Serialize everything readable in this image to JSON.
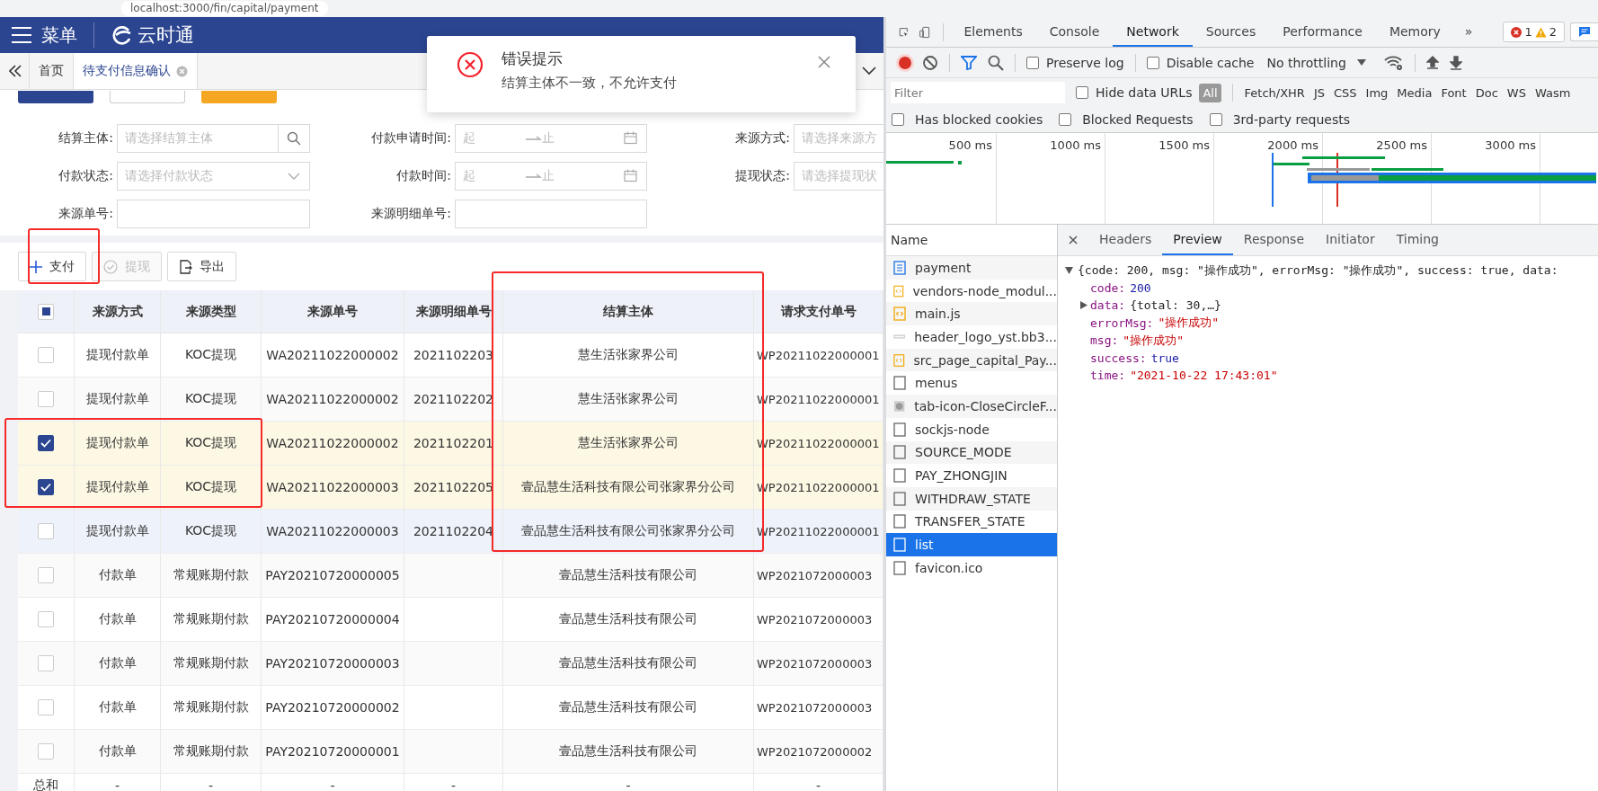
{
  "address_bar": {
    "url": "localhost:3000/fin/capital/payment"
  },
  "header": {
    "menu_label": "菜单",
    "brand": "云时通"
  },
  "page_tabs": [
    {
      "label": "首页",
      "selected": false,
      "closable": false
    },
    {
      "label": "待支付信息确认",
      "selected": true,
      "closable": true
    }
  ],
  "query_buttons": [
    {
      "kind": "primary"
    },
    {
      "kind": "default"
    },
    {
      "kind": "warning"
    }
  ],
  "filters": [
    {
      "label": "结算主体:",
      "kind": "search",
      "placeholder": "请选择结算主体"
    },
    {
      "label": "付款申请时间:",
      "kind": "daterange",
      "start": "起",
      "end": "止"
    },
    {
      "label": "来源方式:",
      "kind": "text",
      "placeholder": "请选择来源方"
    },
    {
      "label": "付款状态:",
      "kind": "select",
      "placeholder": "请选择付款状态"
    },
    {
      "label": "付款时间:",
      "kind": "daterange",
      "start": "起",
      "end": "止"
    },
    {
      "label": "提现状态:",
      "kind": "text",
      "placeholder": "请选择提现状"
    },
    {
      "label": "来源单号:",
      "kind": "text"
    },
    {
      "label": "来源明细单号:",
      "kind": "text"
    }
  ],
  "toolbar": [
    {
      "label": "支付",
      "kind": "add",
      "disabled": false
    },
    {
      "label": "提现",
      "kind": "confirm",
      "disabled": true
    },
    {
      "label": "导出",
      "kind": "export",
      "disabled": false
    }
  ],
  "table": {
    "header_checkbox": {
      "indeterminate": true
    },
    "columns": [
      "来源方式",
      "来源类型",
      "来源单号",
      "来源明细单号",
      "结算主体",
      "请求支付单号"
    ],
    "rows": [
      {
        "checked": false,
        "hovered": false,
        "cells": [
          "提现付款单",
          "KOC提现",
          "WA20211022000002",
          "2021102203",
          "慧生活张家界公司",
          "WP20211022000001"
        ]
      },
      {
        "checked": false,
        "hovered": false,
        "cells": [
          "提现付款单",
          "KOC提现",
          "WA20211022000002",
          "2021102202",
          "慧生活张家界公司",
          "WP20211022000001"
        ]
      },
      {
        "checked": true,
        "hovered": false,
        "cells": [
          "提现付款单",
          "KOC提现",
          "WA20211022000002",
          "2021102201",
          "慧生活张家界公司",
          "WP20211022000001"
        ]
      },
      {
        "checked": true,
        "hovered": false,
        "cells": [
          "提现付款单",
          "KOC提现",
          "WA20211022000003",
          "2021102205",
          "壹品慧生活科技有限公司张家界分公司",
          "WP20211022000001"
        ]
      },
      {
        "checked": false,
        "hovered": true,
        "cells": [
          "提现付款单",
          "KOC提现",
          "WA20211022000003",
          "2021102204",
          "壹品慧生活科技有限公司张家界分公司",
          "WP20211022000001"
        ]
      },
      {
        "checked": false,
        "hovered": false,
        "cells": [
          "付款单",
          "常规账期付款",
          "PAY20210720000005",
          "",
          "壹品慧生活科技有限公司",
          "WP2021072000003"
        ]
      },
      {
        "checked": false,
        "hovered": false,
        "cells": [
          "付款单",
          "常规账期付款",
          "PAY20210720000004",
          "",
          "壹品慧生活科技有限公司",
          "WP2021072000003"
        ]
      },
      {
        "checked": false,
        "hovered": false,
        "cells": [
          "付款单",
          "常规账期付款",
          "PAY20210720000003",
          "",
          "壹品慧生活科技有限公司",
          "WP2021072000003"
        ]
      },
      {
        "checked": false,
        "hovered": false,
        "cells": [
          "付款单",
          "常规账期付款",
          "PAY20210720000002",
          "",
          "壹品慧生活科技有限公司",
          "WP2021072000003"
        ]
      },
      {
        "checked": false,
        "hovered": false,
        "cells": [
          "付款单",
          "常规账期付款",
          "PAY20210720000001",
          "",
          "壹品慧生活科技有限公司",
          "WP2021072000002"
        ]
      }
    ],
    "summary": {
      "label": "总和",
      "cells": [
        "-",
        "-",
        "-",
        "-",
        "-",
        "-"
      ]
    }
  },
  "toast": {
    "title": "错误提示",
    "message": "结算主体不一致，不允许支付"
  },
  "devtools": {
    "panel_tabs": [
      {
        "label": "Elements",
        "selected": false
      },
      {
        "label": "Console",
        "selected": false
      },
      {
        "label": "Network",
        "selected": true
      },
      {
        "label": "Sources",
        "selected": false
      },
      {
        "label": "Performance",
        "selected": false
      },
      {
        "label": "Memory",
        "selected": false
      }
    ],
    "more": "»",
    "errors": "1",
    "warnings": "2",
    "recording": true,
    "options": [
      {
        "label": "Preserve log",
        "checked": false
      },
      {
        "label": "Disable cache",
        "checked": false
      }
    ],
    "throttling": "No throttling",
    "filter": {
      "placeholder": "Filter",
      "hide_data_urls": {
        "label": "Hide data URLs",
        "checked": false
      },
      "types": [
        {
          "label": "All",
          "selected": true
        },
        {
          "label": "Fetch/XHR",
          "selected": false
        },
        {
          "label": "JS",
          "selected": false
        },
        {
          "label": "CSS",
          "selected": false
        },
        {
          "label": "Img",
          "selected": false
        },
        {
          "label": "Media",
          "selected": false
        },
        {
          "label": "Font",
          "selected": false
        },
        {
          "label": "Doc",
          "selected": false
        },
        {
          "label": "WS",
          "selected": false
        },
        {
          "label": "Wasm",
          "selected": false
        }
      ]
    },
    "extra_filters": [
      {
        "label": "Has blocked cookies",
        "checked": false
      },
      {
        "label": "Blocked Requests",
        "checked": false
      },
      {
        "label": "3rd-party requests",
        "checked": false
      }
    ],
    "timeline_ticks": [
      "500 ms",
      "1000 ms",
      "1500 ms",
      "2000 ms",
      "2500 ms",
      "3000 ms"
    ],
    "requests_header": "Name",
    "requests": [
      {
        "name": "payment",
        "kind": "document",
        "selected": false
      },
      {
        "name": "vendors-node_modul...",
        "kind": "script",
        "selected": false
      },
      {
        "name": "main.js",
        "kind": "script",
        "selected": false
      },
      {
        "name": "header_logo_yst.bb3...",
        "kind": "image",
        "selected": false
      },
      {
        "name": "src_page_capital_Pay...",
        "kind": "script",
        "selected": false
      },
      {
        "name": "menus",
        "kind": "fetch",
        "selected": false
      },
      {
        "name": "tab-icon-CloseCircleF...",
        "kind": "svg",
        "selected": false
      },
      {
        "name": "sockjs-node",
        "kind": "fetch",
        "selected": false
      },
      {
        "name": "SOURCE_MODE",
        "kind": "fetch",
        "selected": false
      },
      {
        "name": "PAY_ZHONGJIN",
        "kind": "fetch",
        "selected": false
      },
      {
        "name": "WITHDRAW_STATE",
        "kind": "fetch",
        "selected": false
      },
      {
        "name": "TRANSFER_STATE",
        "kind": "fetch",
        "selected": false
      },
      {
        "name": "list",
        "kind": "fetch",
        "selected": true
      },
      {
        "name": "favicon.ico",
        "kind": "fetch",
        "selected": false
      }
    ],
    "detail_tabs": [
      {
        "label": "Headers",
        "selected": false
      },
      {
        "label": "Preview",
        "selected": true
      },
      {
        "label": "Response",
        "selected": false
      },
      {
        "label": "Initiator",
        "selected": false
      },
      {
        "label": "Timing",
        "selected": false
      }
    ],
    "preview": {
      "summary": "{code: 200, msg: \"操作成功\", errorMsg: \"操作成功\", success: true, data:",
      "fields": [
        {
          "key": "code:",
          "value": "200",
          "kind": "number",
          "expandable": false
        },
        {
          "key": "data:",
          "value": "{total: 30,…}",
          "kind": "object",
          "expandable": true
        },
        {
          "key": "errorMsg:",
          "value": "\"操作成功\"",
          "kind": "string",
          "expandable": false
        },
        {
          "key": "msg:",
          "value": "\"操作成功\"",
          "kind": "string",
          "expandable": false
        },
        {
          "key": "success:",
          "value": "true",
          "kind": "boolean",
          "expandable": false
        },
        {
          "key": "time:",
          "value": "\"2021-10-22 17:43:01\"",
          "kind": "string",
          "expandable": false
        }
      ]
    }
  }
}
